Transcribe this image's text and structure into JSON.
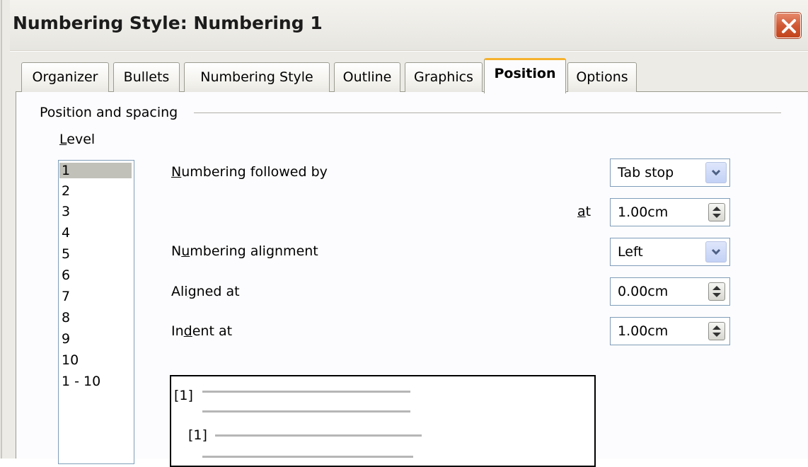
{
  "window": {
    "title": "Numbering Style: Numbering 1"
  },
  "tabs": [
    {
      "label": "Organizer"
    },
    {
      "label": "Bullets"
    },
    {
      "label": "Numbering Style"
    },
    {
      "label": "Outline"
    },
    {
      "label": "Graphics"
    },
    {
      "label": "Position",
      "active": true
    },
    {
      "label": "Options"
    }
  ],
  "section": {
    "title": "Position and spacing"
  },
  "level": {
    "label_first": "L",
    "label_rest": "evel",
    "items": [
      "1",
      "2",
      "3",
      "4",
      "5",
      "6",
      "7",
      "8",
      "9",
      "10",
      "1 - 10"
    ],
    "selected": "1"
  },
  "fields": {
    "numbering_followed_by": {
      "label_first": "N",
      "label_rest": "umbering followed by",
      "value": "Tab stop"
    },
    "at": {
      "label_first": "a",
      "label_rest": "t",
      "value": "1.00cm"
    },
    "numbering_alignment": {
      "label_pre": "N",
      "label_ul": "u",
      "label_rest": "mbering alignment",
      "value": "Left"
    },
    "aligned_at": {
      "label_pre": "Ali",
      "label_ul": "g",
      "label_rest": "ned at",
      "value": "0.00cm"
    },
    "indent_at": {
      "label_pre": "In",
      "label_ul": "d",
      "label_rest": "ent at",
      "value": "1.00cm"
    }
  },
  "preview": {
    "marker_1": "[1]",
    "marker_2": "[1]"
  },
  "colors": {
    "close_button": "#d05a36",
    "active_tab_accent": "#f6b22e",
    "selection": "#c1c0b9"
  }
}
